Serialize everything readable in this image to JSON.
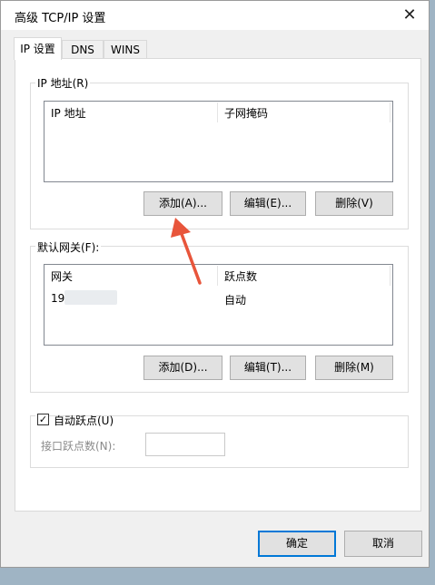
{
  "window": {
    "title": "高级 TCP/IP 设置",
    "close_glyph": "✕"
  },
  "tabs": [
    {
      "label": "IP 设置",
      "active": true
    },
    {
      "label": "DNS",
      "active": false
    },
    {
      "label": "WINS",
      "active": false
    }
  ],
  "ip_group": {
    "label": "IP 地址(R)",
    "columns": [
      "IP 地址",
      "子网掩码"
    ],
    "buttons": {
      "add": "添加(A)...",
      "edit": "编辑(E)...",
      "remove": "删除(V)"
    }
  },
  "gateway_group": {
    "label": "默认网关(F):",
    "columns": [
      "网关",
      "跃点数"
    ],
    "rows": [
      {
        "gateway": "19",
        "metric": "自动"
      }
    ],
    "buttons": {
      "add": "添加(D)...",
      "edit": "编辑(T)...",
      "remove": "删除(M)"
    }
  },
  "metric_group": {
    "checkbox_label": "自动跃点(U)",
    "checked": true,
    "check_glyph": "✓",
    "field_label": "接口跃点数(N):",
    "field_value": ""
  },
  "footer": {
    "ok": "确定",
    "cancel": "取消"
  },
  "colors": {
    "annotation_arrow": "#e8553b",
    "primary_border": "#0078d7"
  }
}
